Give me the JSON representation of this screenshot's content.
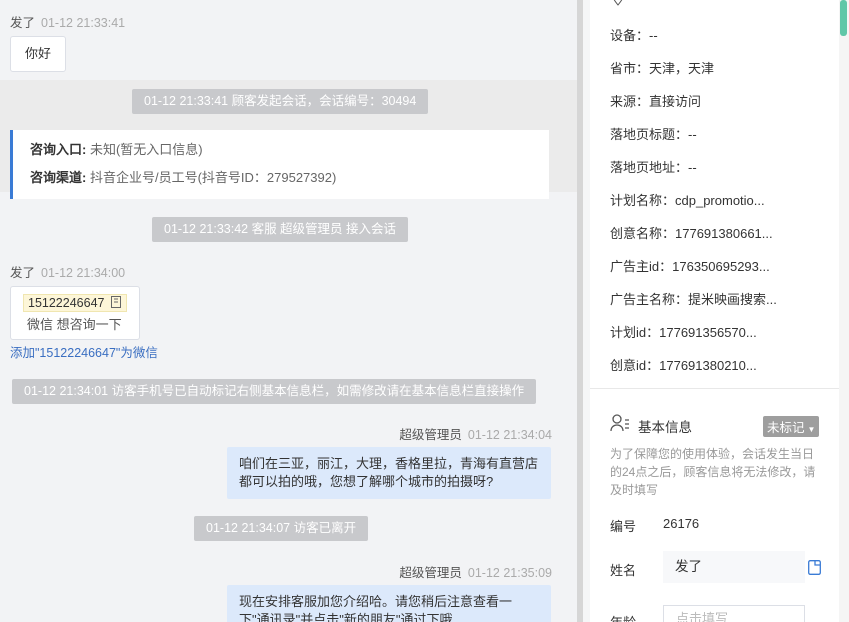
{
  "chat": {
    "msg1": {
      "sender": "发了",
      "time": "01-12 21:33:41",
      "text": "你好"
    },
    "sys1": "01-12 21:33:41 顾客发起会话，会话编号：30494",
    "info": {
      "entry_label": "咨询入口:",
      "entry_value": "未知(暂无入口信息)",
      "channel_label": "咨询渠道:",
      "channel_value": "抖音企业号/员工号(抖音号ID：279527392)"
    },
    "sys2": "01-12 21:33:42 客服 超级管理员 接入会话",
    "msg2": {
      "sender": "发了",
      "time": "01-12 21:34:00",
      "phone": "15122246647",
      "text": "微信 想咨询一下"
    },
    "add_wechat": "添加\"15122246647\"为微信",
    "sys3": "01-12 21:34:01 访客手机号已自动标记右侧基本信息栏，如需修改请在基本信息栏直接操作",
    "msg3": {
      "sender": "超级管理员",
      "time": "01-12 21:34:04",
      "text": "咱们在三亚，丽江，大理，香格里拉，青海有直营店都可以拍的哦，您想了解哪个城市的拍摄呀?"
    },
    "sys4": "01-12 21:34:07 访客已离开",
    "msg4": {
      "sender": "超级管理员",
      "time": "01-12 21:35:09",
      "text": "现在安排客服加您介绍哈。请您稍后注意查看一下\"通讯录\"并点击\"新的朋友\"通过下哦"
    }
  },
  "panel": {
    "rows": [
      {
        "label": "设备：",
        "value": "--"
      },
      {
        "label": "省市：",
        "value": "天津，天津"
      },
      {
        "label": "来源：",
        "value": "直接访问"
      },
      {
        "label": "落地页标题：",
        "value": "--"
      },
      {
        "label": "落地页地址：",
        "value": "--"
      },
      {
        "label": "计划名称：",
        "value": "cdp_promotio..."
      },
      {
        "label": "创意名称：",
        "value": "177691380661..."
      },
      {
        "label": "广告主id：",
        "value": "176350695293..."
      },
      {
        "label": "广告主名称：",
        "value": "提米映画搜索..."
      },
      {
        "label": "计划id：",
        "value": "177691356570..."
      },
      {
        "label": "创意id：",
        "value": "177691380210..."
      }
    ],
    "basic_title": "基本信息",
    "tag": "未标记",
    "note": "为了保障您的使用体验，会话发生当日的24点之后，顾客信息将无法修改，请及时填写",
    "id_label": "编号",
    "id_value": "26176",
    "name_label": "姓名",
    "name_value": "发了",
    "age_label": "年龄",
    "age_placeholder": "点击填写"
  }
}
